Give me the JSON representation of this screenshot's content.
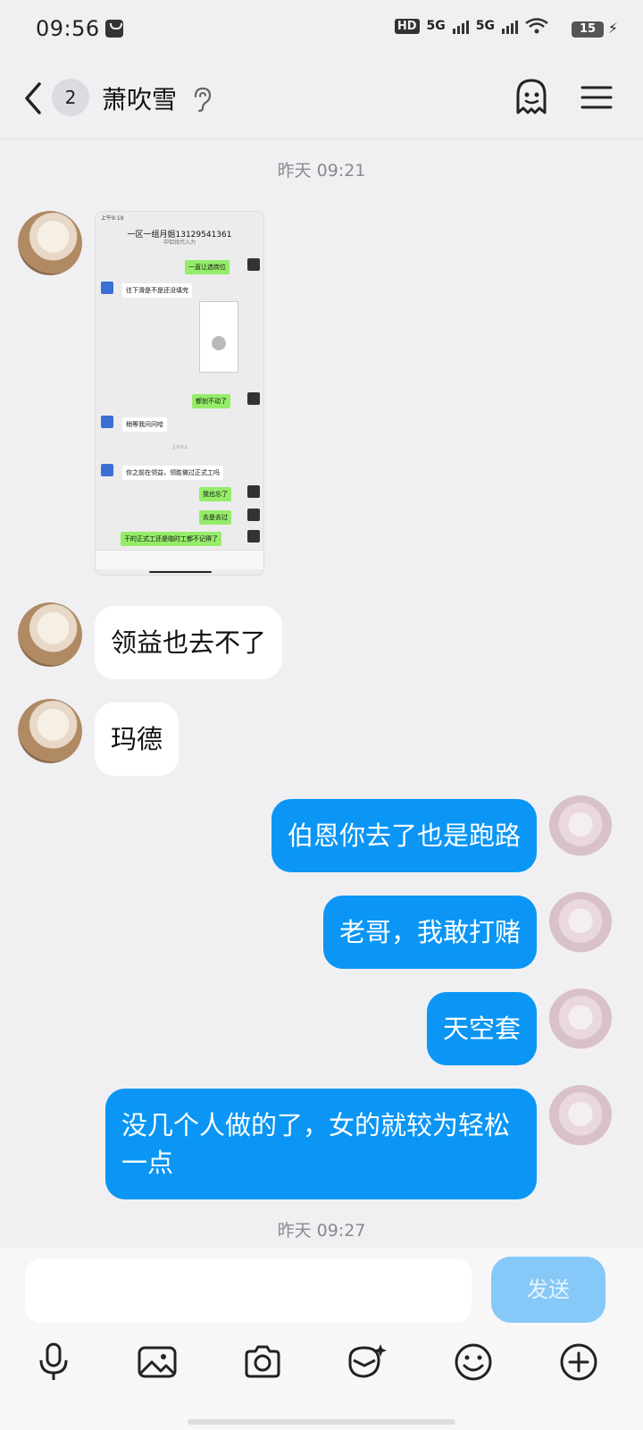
{
  "status_bar": {
    "time": "09:56",
    "hd": "HD",
    "net1": "5G",
    "net2": "5G",
    "battery": "15"
  },
  "header": {
    "unread_count": "2",
    "title": "萧吹雪"
  },
  "timestamps": {
    "first": "昨天 09:21",
    "second": "昨天 09:27"
  },
  "image_message": {
    "status_time": "上午9:19",
    "title": "一区一组月姐13129541361",
    "subtitle": "中铝伐代入力",
    "lines": [
      "一直让选岗位",
      "往下滑是不是还没填完",
      "都划不动了",
      "稍等我问问哈",
      "你之前在领益，领胜做过正式工吗",
      "我也忘了",
      "去是去过",
      "干的正式工还是临时工都不记得了"
    ],
    "time_divider": "上午9:1"
  },
  "messages": [
    {
      "side": "in",
      "text": "领益也去不了"
    },
    {
      "side": "in",
      "text": "玛德"
    },
    {
      "side": "out",
      "text": "伯恩你去了也是跑路"
    },
    {
      "side": "out",
      "text": "老哥，我敢打赌"
    },
    {
      "side": "out",
      "text": "天空套"
    },
    {
      "side": "out",
      "text": "没几个人做的了，女的就较为轻松一点"
    }
  ],
  "input": {
    "placeholder": "",
    "send_label": "发送"
  },
  "colors": {
    "outgoing_bubble": "#0b96f5",
    "send_button_disabled": "#86c8f7",
    "background": "#f0f0f3"
  },
  "toolbar_icons": [
    "microphone-icon",
    "image-icon",
    "camera-icon",
    "sticker-icon",
    "emoji-icon",
    "plus-icon"
  ]
}
